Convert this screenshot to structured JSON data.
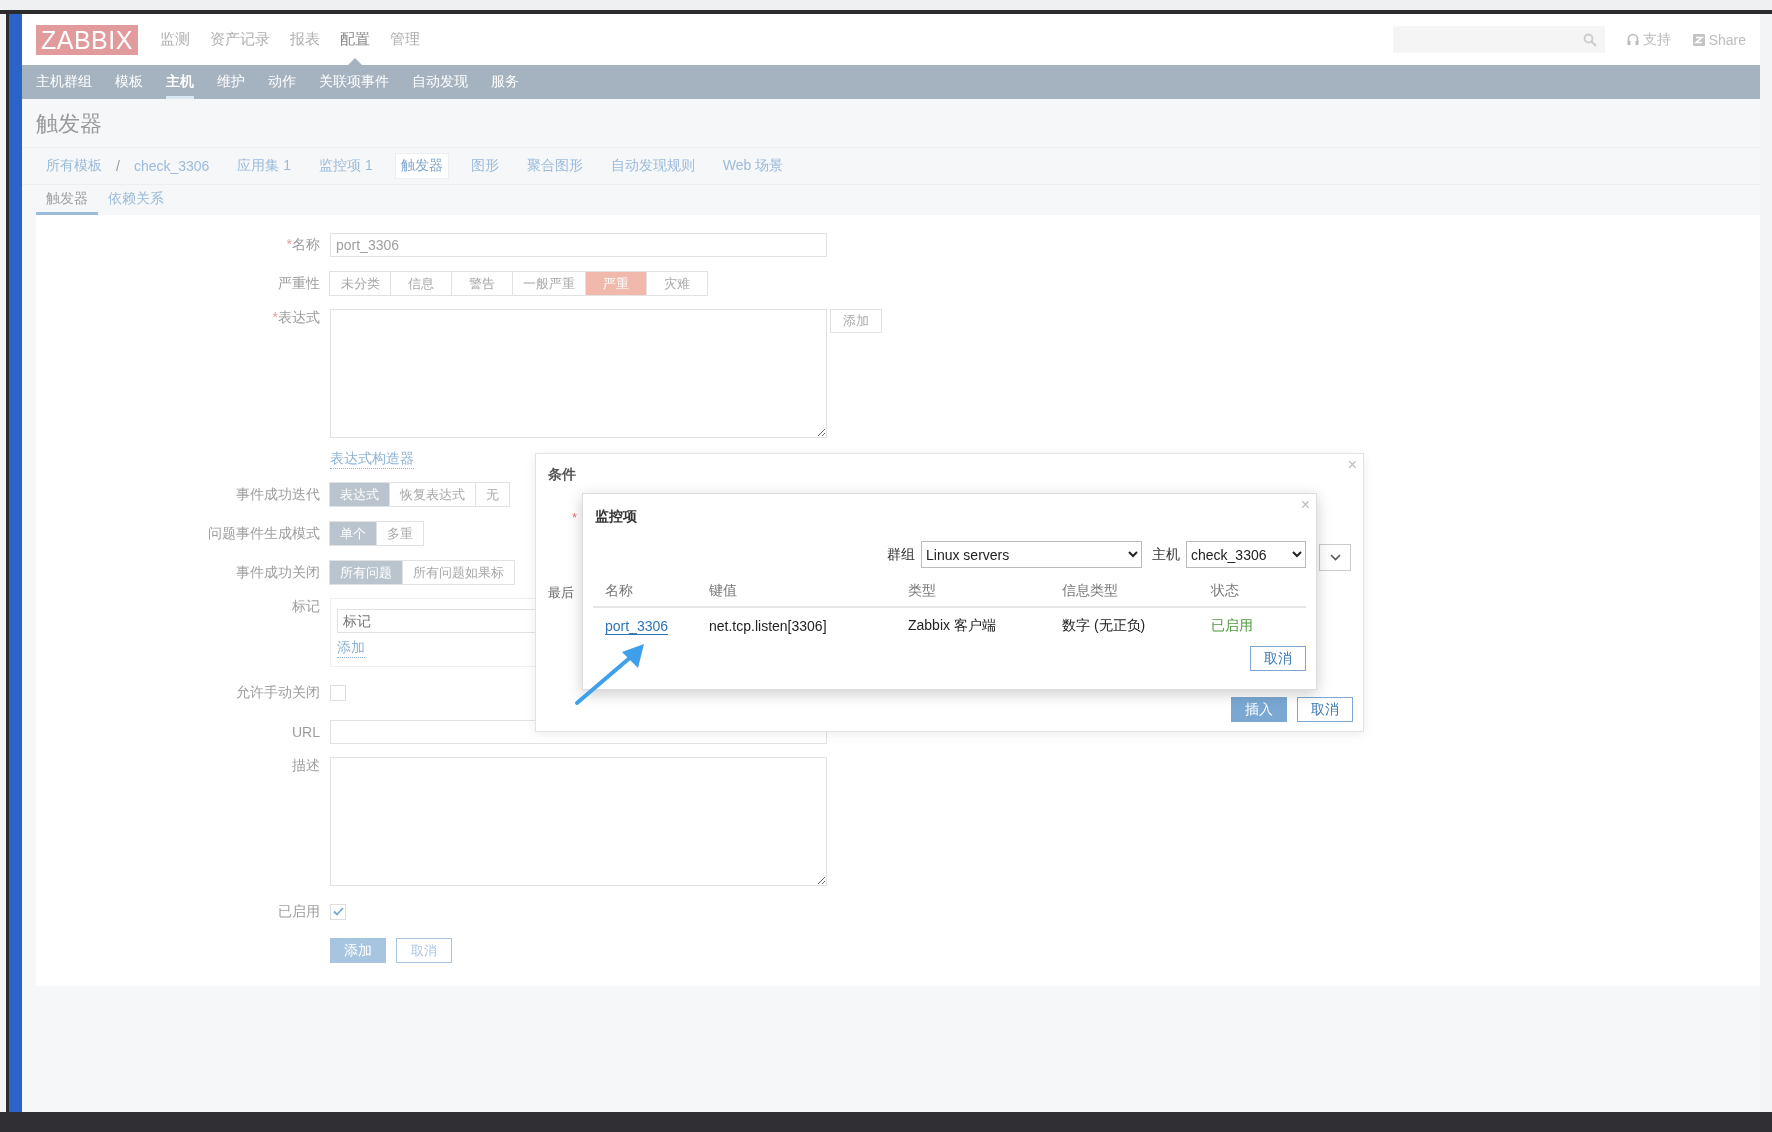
{
  "header": {
    "logo": "ZABBIX",
    "menu": [
      {
        "label": "监测",
        "selected": false
      },
      {
        "label": "资产记录",
        "selected": false
      },
      {
        "label": "报表",
        "selected": false
      },
      {
        "label": "配置",
        "selected": true
      },
      {
        "label": "管理",
        "selected": false
      }
    ],
    "support": "支持",
    "share": "Share"
  },
  "subnav": [
    {
      "label": "主机群组",
      "selected": false
    },
    {
      "label": "模板",
      "selected": false
    },
    {
      "label": "主机",
      "selected": true
    },
    {
      "label": "维护",
      "selected": false
    },
    {
      "label": "动作",
      "selected": false
    },
    {
      "label": "关联项事件",
      "selected": false
    },
    {
      "label": "自动发现",
      "selected": false
    },
    {
      "label": "服务",
      "selected": false
    }
  ],
  "page_title": "触发器",
  "breadcrumbs": {
    "path": [
      "所有模板",
      "check_3306"
    ],
    "separator": "/",
    "links": [
      {
        "label": "应用集 1",
        "selected": false
      },
      {
        "label": "监控项 1",
        "selected": false
      },
      {
        "label": "触发器",
        "selected": true
      },
      {
        "label": "图形",
        "selected": false
      },
      {
        "label": "聚合图形",
        "selected": false
      },
      {
        "label": "自动发现规则",
        "selected": false
      },
      {
        "label": "Web 场景",
        "selected": false
      }
    ]
  },
  "tabs": [
    {
      "label": "触发器",
      "selected": true
    },
    {
      "label": "依赖关系",
      "selected": false
    }
  ],
  "form": {
    "required_mark": "*",
    "name": {
      "label": "名称",
      "required": true,
      "value": "port_3306"
    },
    "severity": {
      "label": "严重性",
      "options": [
        {
          "label": "未分类",
          "selected": false
        },
        {
          "label": "信息",
          "selected": false
        },
        {
          "label": "警告",
          "selected": false
        },
        {
          "label": "一般严重",
          "selected": false
        },
        {
          "label": "严重",
          "selected": true
        },
        {
          "label": "灾难",
          "selected": false
        }
      ]
    },
    "expression": {
      "label": "表达式",
      "required": true,
      "add_button": "添加",
      "builder_link": "表达式构造器"
    },
    "ok_event_generation": {
      "label": "事件成功迭代",
      "options": [
        {
          "label": "表达式",
          "selected": true
        },
        {
          "label": "恢复表达式",
          "selected": false
        },
        {
          "label": "无",
          "selected": false
        }
      ]
    },
    "problem_mode": {
      "label": "问题事件生成模式",
      "options": [
        {
          "label": "单个",
          "selected": true
        },
        {
          "label": "多重",
          "selected": false
        }
      ]
    },
    "ok_close": {
      "label": "事件成功关闭",
      "options": [
        {
          "label": "所有问题",
          "selected": true
        },
        {
          "label": "所有问题如果标",
          "selected": false
        }
      ]
    },
    "tags": {
      "label": "标记",
      "placeholder": "标记",
      "add_link": "添加"
    },
    "manual_close": {
      "label": "允许手动关闭",
      "checked": false
    },
    "url": {
      "label": "URL"
    },
    "description": {
      "label": "描述"
    },
    "enabled": {
      "label": "已启用",
      "checked": true
    },
    "buttons": [
      {
        "label": "添加",
        "kind": "primary"
      },
      {
        "label": "取消",
        "kind": "secondary"
      }
    ]
  },
  "condition_dialog": {
    "title": "条件",
    "close": "×",
    "required_mark": "*",
    "partial_label": "最后",
    "buttons": [
      {
        "label": "插入",
        "kind": "primary"
      },
      {
        "label": "取消",
        "kind": "secondary"
      }
    ]
  },
  "item_dialog": {
    "title": "监控项",
    "close": "×",
    "group_label": "群组",
    "group_value": "Linux servers",
    "host_label": "主机",
    "host_value": "check_3306",
    "columns": [
      "名称",
      "键值",
      "类型",
      "信息类型",
      "状态"
    ],
    "rows": [
      {
        "name": "port_3306",
        "key": "net.tcp.listen[3306]",
        "type": "Zabbix 客户端",
        "info_type": "数字 (无正负)",
        "status": "已启用",
        "enabled": true
      }
    ],
    "cancel": "取消"
  }
}
